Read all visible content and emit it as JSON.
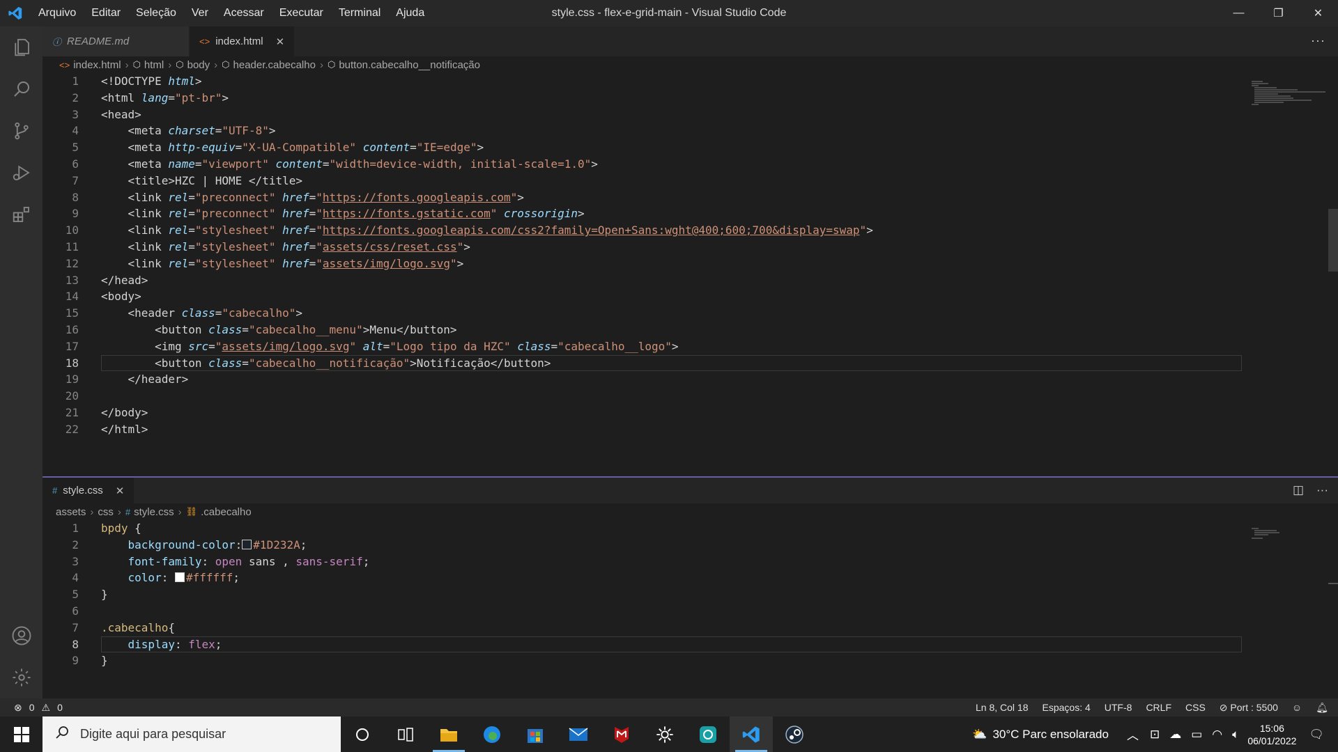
{
  "titlebar": {
    "menu": [
      "Arquivo",
      "Editar",
      "Seleção",
      "Ver",
      "Acessar",
      "Executar",
      "Terminal",
      "Ajuda"
    ],
    "title": "style.css - flex-e-grid-main - Visual Studio Code",
    "controls": {
      "minimize": "—",
      "restore": "❐",
      "close": "✕"
    }
  },
  "editor_top": {
    "tabs": [
      {
        "label": "README.md",
        "icon": "info-icon"
      },
      {
        "label": "index.html",
        "icon": "html-icon",
        "active": true
      }
    ],
    "more": "···",
    "breadcrumb": [
      "index.html",
      "html",
      "body",
      "header.cabecalho",
      "button.cabecalho__notificação"
    ],
    "lines": [
      "1",
      "2",
      "3",
      "4",
      "5",
      "6",
      "7",
      "8",
      "9",
      "10",
      "11",
      "12",
      "13",
      "14",
      "15",
      "16",
      "17",
      "18",
      "19",
      "20",
      "21",
      "22"
    ],
    "current_line": 18
  },
  "editor_bottom": {
    "tab": {
      "label": "style.css",
      "icon": "#"
    },
    "breadcrumb": [
      "assets",
      "css",
      "style.css",
      ".cabecalho"
    ],
    "lines": [
      "1",
      "2",
      "3",
      "4",
      "5",
      "6",
      "7",
      "8",
      "9"
    ],
    "current_line": 8,
    "colors": {
      "bg_swatch": "#1D232A",
      "fg_swatch": "#ffffff"
    }
  },
  "statusbar": {
    "errors": "0",
    "warnings": "0",
    "position": "Ln 8, Col 18",
    "spaces": "Espaços: 4",
    "encoding": "UTF-8",
    "eol": "CRLF",
    "language": "CSS",
    "port": "Port : 5500"
  },
  "taskbar": {
    "search_placeholder": "Digite aqui para pesquisar",
    "weather": "30°C  Parc ensolarado",
    "time": "15:06",
    "date": "06/01/2022"
  },
  "theme": {
    "accent": "#007acc",
    "separator": "#6b5ba8"
  }
}
